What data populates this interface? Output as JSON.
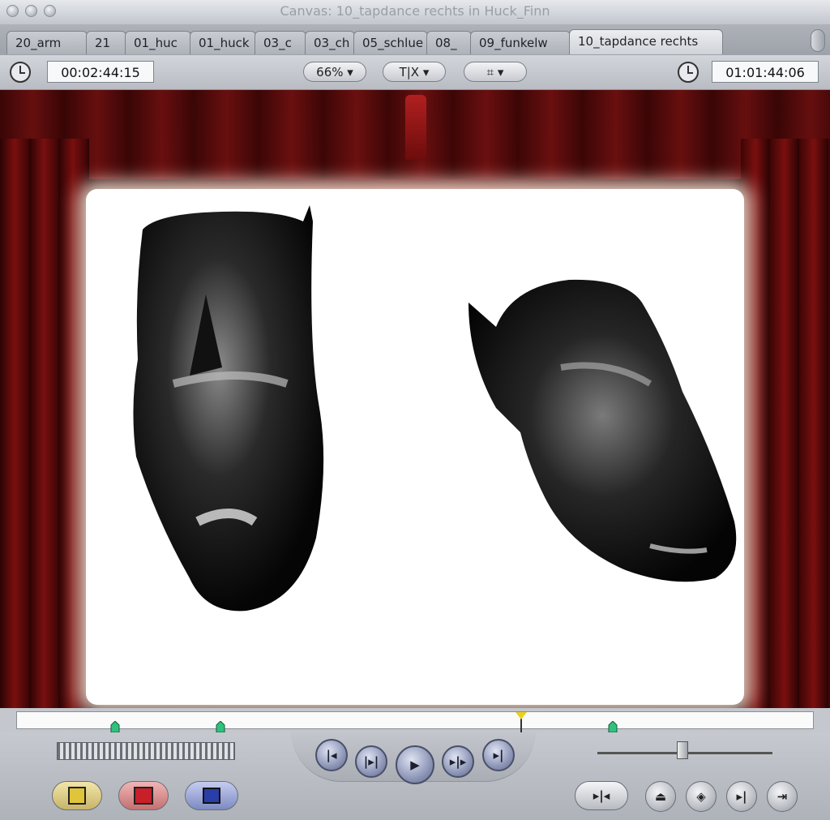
{
  "window": {
    "title": "Canvas: 10_tapdance rechts in Huck_Finn"
  },
  "tabs": [
    {
      "label": "20_arm"
    },
    {
      "label": "21"
    },
    {
      "label": "01_huc"
    },
    {
      "label": "01_huck"
    },
    {
      "label": "03_c"
    },
    {
      "label": "03_ch"
    },
    {
      "label": "05_schlue"
    },
    {
      "label": "08_"
    },
    {
      "label": "09_funkelw"
    },
    {
      "label": "10_tapdance rechts"
    }
  ],
  "toolbar": {
    "duration_timecode": "00:02:44:15",
    "zoom": "66%",
    "view_label": "T|X",
    "fit_icon": "frame-icon",
    "current_timecode": "01:01:44:06"
  },
  "scrubber": {
    "marker_positions_percent": [
      12.3,
      25.6,
      74.8
    ],
    "playhead_percent": 63.2
  },
  "transport": {
    "buttons": [
      "go-to-in-icon",
      "prev-edit-icon",
      "play-icon",
      "next-edit-icon",
      "go-to-out-icon"
    ],
    "bottom_left": [
      "insert-edit-icon",
      "mark-in-icon",
      "overlay-icon"
    ],
    "bottom_right": [
      "match-frame-icon",
      "mark-clip-icon",
      "add-keyframe-icon",
      "mark-out-icon",
      "go-to-end-icon"
    ]
  },
  "colors": {
    "curtain": "#6e1010",
    "screen": "#ffffff",
    "marker": "#2ec27e",
    "playhead": "#e8d21c"
  }
}
